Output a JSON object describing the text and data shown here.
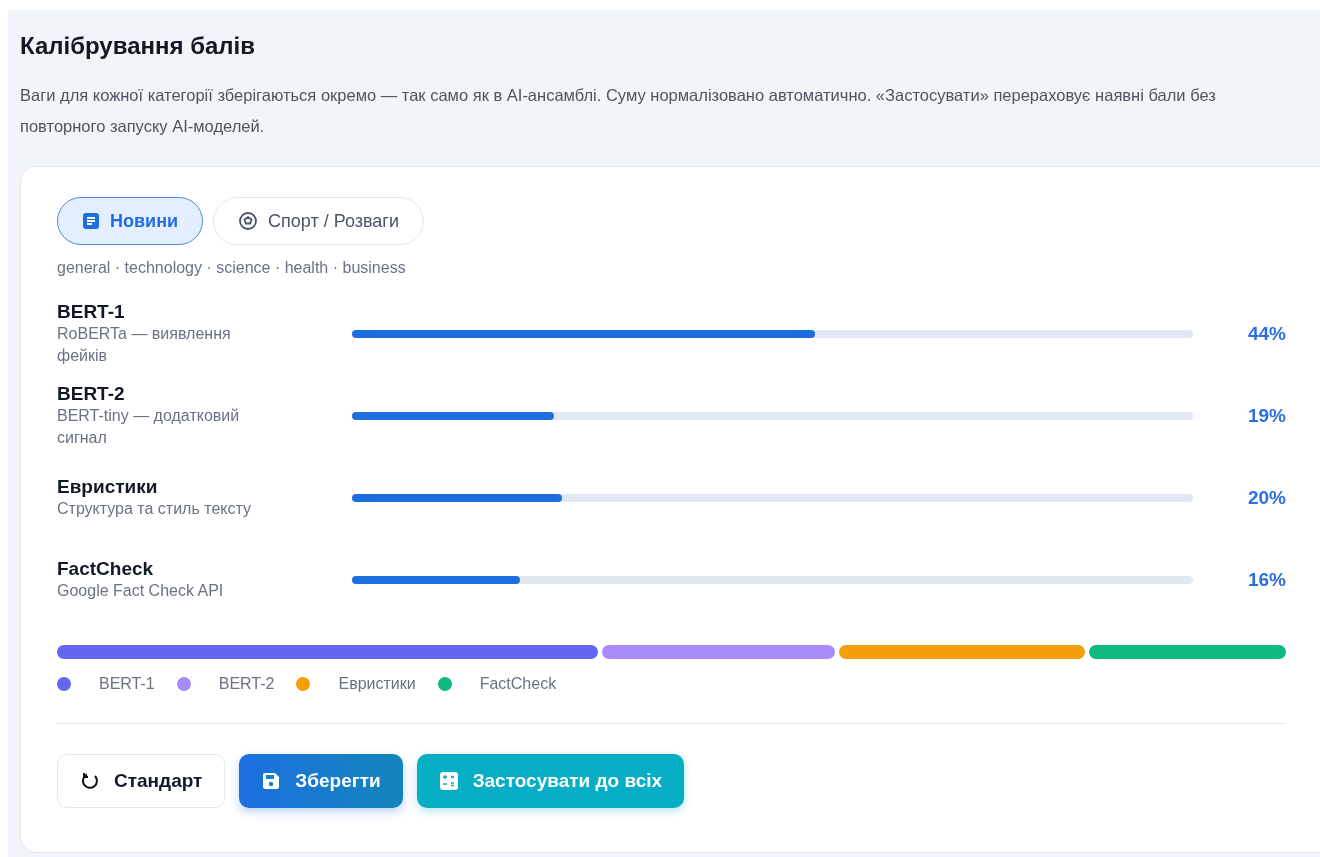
{
  "title": "Калібрування балів",
  "description": "Ваги для кожної категорії зберігаються окремо — так само як в AI-ансамблі. Суму нормалізовано автоматично. «Застосувати» перераховує наявні бали без повторного запуску AI-моделей.",
  "tabs": [
    {
      "label": "Новини",
      "selected": true,
      "kind": "news"
    },
    {
      "label": "Спорт / Розваги",
      "selected": false,
      "kind": "sport"
    }
  ],
  "categories": "general · technology · science · health · business",
  "models": [
    {
      "name": "BERT-1",
      "subtitle": "RoBERTa — виявлення фейків",
      "level": 0.55,
      "reading": "44%"
    },
    {
      "name": "BERT-2",
      "subtitle": "BERT-tiny — додатковий сигнал",
      "level": 0.24,
      "reading": "19%"
    },
    {
      "name": "Евристики",
      "subtitle": "Структура та стиль тексту",
      "level": 0.25,
      "reading": "20%"
    },
    {
      "name": "FactCheck",
      "subtitle": "Google Fact Check API",
      "level": 0.2,
      "reading": "16%"
    }
  ],
  "mix": [
    {
      "color": "#6366f1"
    },
    {
      "color": "#a78bfa"
    },
    {
      "color": "#f59e0b"
    },
    {
      "color": "#10b981"
    }
  ],
  "legend": [
    {
      "label": "BERT-1",
      "color": "#6366f1"
    },
    {
      "label": "BERT-2",
      "color": "#a78bfa"
    },
    {
      "label": "Евристики",
      "color": "#f59e0b"
    },
    {
      "label": "FactCheck",
      "color": "#10b981"
    }
  ],
  "buttons": [
    {
      "label": "Стандарт",
      "kind": "reset"
    },
    {
      "label": "Зберегти",
      "kind": "save"
    },
    {
      "label": "Застосувати до всіх",
      "kind": "apply"
    }
  ]
}
